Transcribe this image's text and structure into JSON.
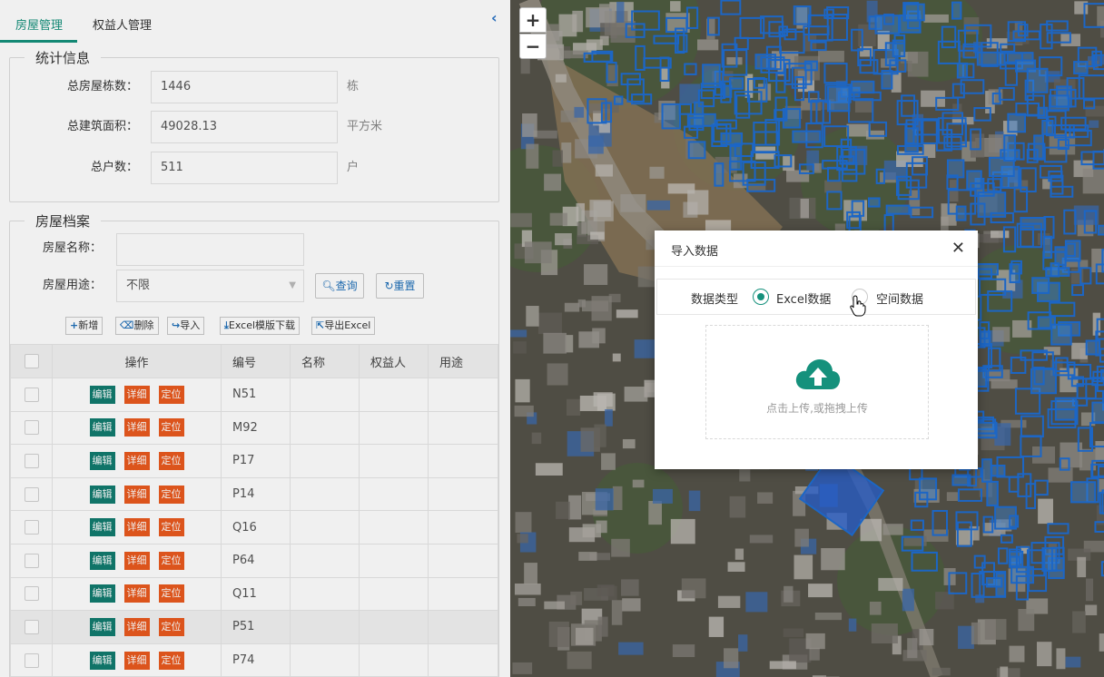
{
  "tabs": [
    {
      "label": "房屋管理",
      "active": true
    },
    {
      "label": "权益人管理",
      "active": false
    }
  ],
  "collapse_icon": "‹",
  "stats": {
    "title": "统计信息",
    "rows": [
      {
        "label": "总房屋栋数：",
        "value": "1446",
        "unit": "栋"
      },
      {
        "label": "总建筑面积：",
        "value": "49028.13",
        "unit": "平方米"
      },
      {
        "label": "总户数：",
        "value": "511",
        "unit": "户"
      }
    ]
  },
  "archive": {
    "title": "房屋档案",
    "name_label": "房屋名称：",
    "name_value": "",
    "usage_label": "房屋用途：",
    "usage_value": "不限",
    "query_label": "查询",
    "reset_label": "重置"
  },
  "toolbar": {
    "add": "新增",
    "delete": "删除",
    "import": "导入",
    "download_template": "Excel模版下载",
    "export": "导出Excel"
  },
  "table": {
    "headers": [
      "操作",
      "编号",
      "名称",
      "权益人",
      "用途"
    ],
    "action_labels": {
      "edit": "编辑",
      "detail": "详细",
      "locate": "定位"
    },
    "rows": [
      {
        "code": "N51",
        "name": "",
        "owner": "",
        "usage": ""
      },
      {
        "code": "M92",
        "name": "",
        "owner": "",
        "usage": ""
      },
      {
        "code": "P17",
        "name": "",
        "owner": "",
        "usage": ""
      },
      {
        "code": "P14",
        "name": "",
        "owner": "",
        "usage": ""
      },
      {
        "code": "Q16",
        "name": "",
        "owner": "",
        "usage": ""
      },
      {
        "code": "P64",
        "name": "",
        "owner": "",
        "usage": ""
      },
      {
        "code": "Q11",
        "name": "",
        "owner": "",
        "usage": ""
      },
      {
        "code": "P51",
        "name": "",
        "owner": "",
        "usage": ""
      },
      {
        "code": "P74",
        "name": "",
        "owner": "",
        "usage": ""
      }
    ],
    "highlight_row": 7
  },
  "map": {
    "zoom_in": "+",
    "zoom_out": "−"
  },
  "modal": {
    "title": "导入数据",
    "close": "✕",
    "type_label": "数据类型",
    "options": [
      {
        "label": "Excel数据",
        "selected": true
      },
      {
        "label": "空间数据",
        "selected": false
      }
    ],
    "upload_text": "点击上传,或拖拽上传"
  },
  "colors": {
    "accent": "#15917c",
    "edit_button": "#117c6f",
    "detail_button": "#ea5a1e",
    "building_outline": "#1f6fd6"
  }
}
